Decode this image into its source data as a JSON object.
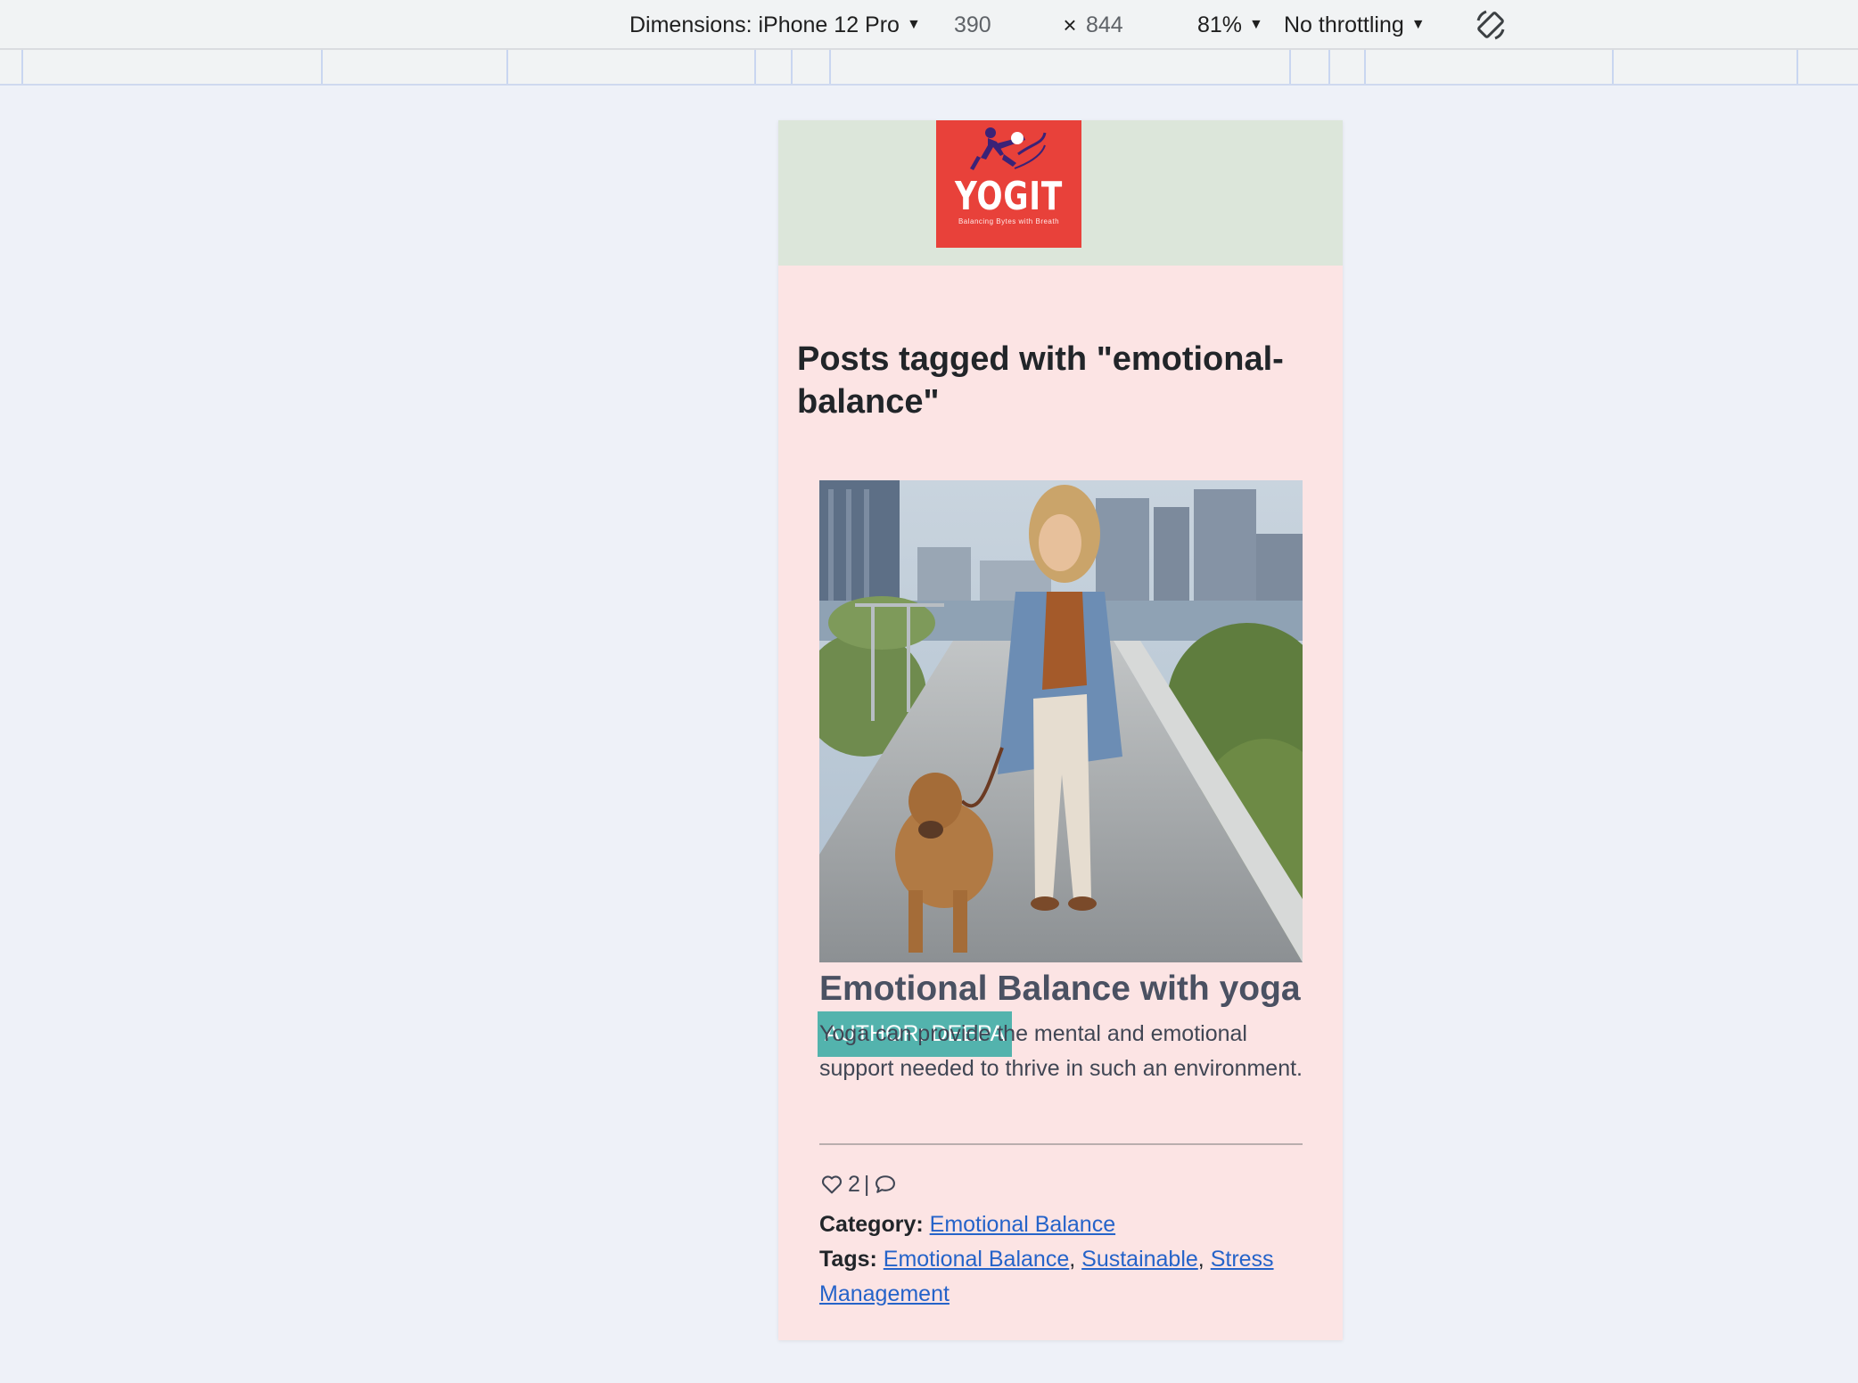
{
  "devtools": {
    "dimensions_label": "Dimensions: iPhone 12 Pro",
    "width": "390",
    "times": "×",
    "height": "844",
    "zoom": "81%",
    "throttling": "No throttling",
    "icons": {
      "caret": "caret-down-icon",
      "rotate": "rotate-icon"
    }
  },
  "site": {
    "logo": {
      "wordmark": "YOGIT",
      "tagline": "Balancing Bytes with Breath"
    }
  },
  "page": {
    "title": "Posts tagged with \"emotional-balance\""
  },
  "post": {
    "author_badge": "AUTHOR: DEEPA",
    "title": "Emotional Balance with yoga",
    "excerpt": "Yoga can provide the mental and emotional support needed to thrive in such an environment.",
    "likes": "2",
    "separator": "|",
    "category_label": "Category:",
    "category": "Emotional Balance",
    "tags_label": "Tags:",
    "tags": [
      "Emotional Balance",
      "Sustainable",
      "Stress Management"
    ],
    "tag_separator": ", "
  },
  "colors": {
    "header_bg": "#dce6da",
    "page_bg": "#fce4e4",
    "logo_bg": "#e8413a",
    "badge_bg": "#53b3ad",
    "link": "#2563c9"
  }
}
